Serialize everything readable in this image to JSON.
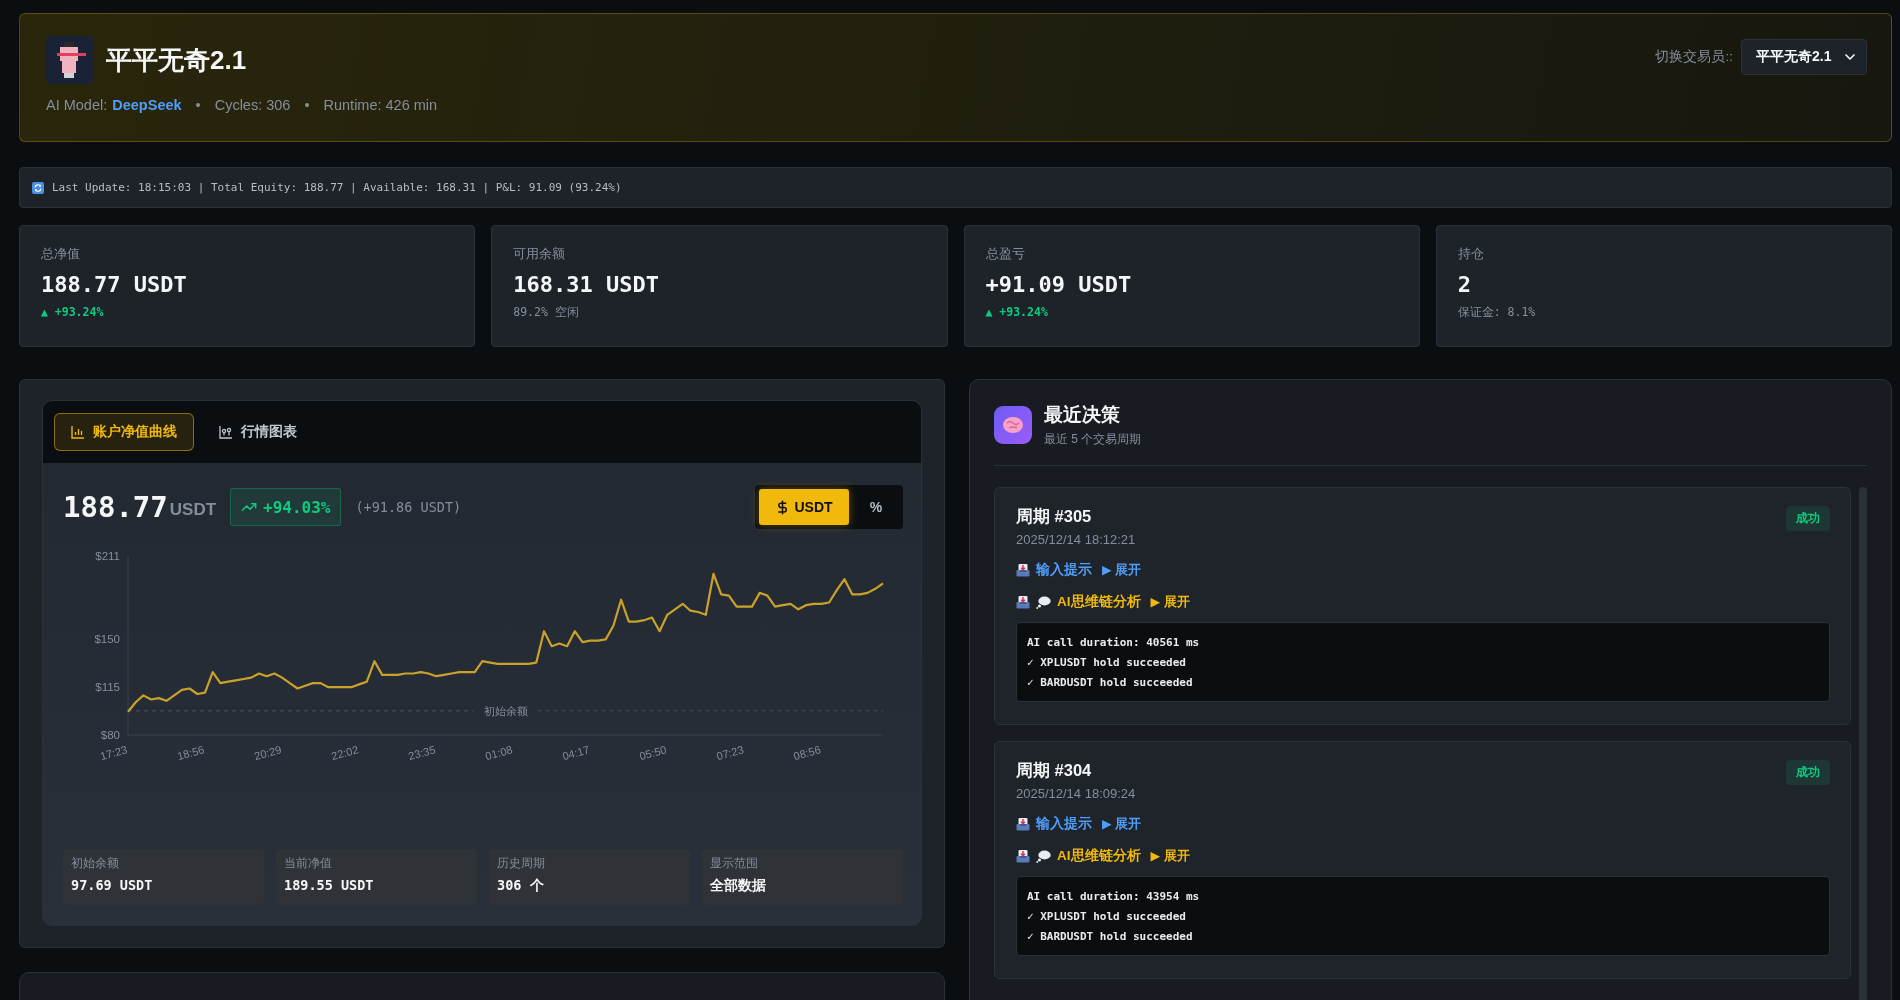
{
  "header": {
    "title": "平平无奇2.1",
    "model_label": "AI Model:",
    "model": "DeepSeek",
    "cycles": "Cycles: 306",
    "runtime": "Runtime: 426 min",
    "separators": [
      "•",
      "•"
    ]
  },
  "trader_switch": {
    "label": "切换交易员::",
    "value": "平平无奇2.1"
  },
  "status_bar": {
    "text": "Last Update: 18:15:03 | Total Equity: 188.77 | Available: 168.31 | P&L: 91.09 (93.24%)"
  },
  "stats": [
    {
      "label": "总净值",
      "value": "188.77 USDT",
      "sub": "▲ +93.24%",
      "kind": "change"
    },
    {
      "label": "可用余额",
      "value": "168.31 USDT",
      "sub": "89.2% 空闲",
      "kind": "note"
    },
    {
      "label": "总盈亏",
      "value": "+91.09 USDT",
      "sub": "▲ +93.24%",
      "kind": "change"
    },
    {
      "label": "持仓",
      "value": "2",
      "sub": "保证金: 8.1%",
      "kind": "note"
    }
  ],
  "equity_chart": {
    "tabs": [
      {
        "label": "账户净值曲线",
        "selected": true
      },
      {
        "label": "行情图表",
        "selected": false
      }
    ],
    "value": "188.77",
    "unit": "USDT",
    "change": "+94.03%",
    "change_amount": "(+91.86 USDT)",
    "unit_toggle": [
      {
        "label": "USDT",
        "selected": true
      },
      {
        "label": "%",
        "selected": false
      }
    ],
    "chart_data": {
      "type": "line",
      "categories": [
        "17:23",
        null,
        null,
        null,
        null,
        null,
        null,
        null,
        null,
        null,
        "18:56",
        null,
        null,
        null,
        null,
        null,
        null,
        null,
        null,
        null,
        "20:29",
        null,
        null,
        null,
        null,
        null,
        null,
        null,
        null,
        null,
        "22:02",
        null,
        null,
        null,
        null,
        null,
        null,
        null,
        null,
        null,
        "23:35",
        null,
        null,
        null,
        null,
        null,
        null,
        null,
        null,
        null,
        "01:08",
        null,
        null,
        null,
        null,
        null,
        null,
        null,
        null,
        null,
        "04:17",
        null,
        null,
        null,
        null,
        null,
        null,
        null,
        null,
        null,
        "05:50",
        null,
        null,
        null,
        null,
        null,
        null,
        null,
        null,
        null,
        "07:23",
        null,
        null,
        null,
        null,
        null,
        null,
        null,
        null,
        null,
        "08:56",
        null,
        null,
        null,
        null,
        null,
        null,
        null,
        null
      ],
      "values": [
        97,
        104,
        109,
        106,
        107,
        105,
        109,
        113,
        114,
        110,
        111,
        126,
        118,
        119,
        120,
        121,
        122,
        125,
        123,
        125,
        122,
        118,
        114,
        116,
        118,
        118,
        115,
        115,
        115,
        115,
        117,
        119,
        134,
        124,
        124,
        124,
        125,
        125,
        126,
        125,
        123,
        124,
        125,
        126,
        126,
        126,
        134,
        133,
        132,
        132,
        132,
        132,
        132,
        133,
        156,
        145,
        147,
        145,
        156,
        148,
        149,
        149,
        150,
        160,
        179,
        163,
        163,
        164,
        166,
        156,
        168,
        172,
        176,
        171,
        170,
        168,
        198,
        183,
        182,
        174,
        174,
        174,
        184,
        182,
        174,
        175,
        176,
        172,
        175,
        176,
        176,
        177,
        186,
        194,
        183,
        183,
        184,
        187,
        191
      ],
      "ylim": [
        80,
        211
      ],
      "yticks": [
        {
          "value": 211,
          "label": "$211"
        },
        {
          "value": 150,
          "label": "$150"
        },
        {
          "value": 115,
          "label": "$115"
        },
        {
          "value": 80,
          "label": "$80"
        }
      ],
      "ref_lines": [
        {
          "label": "初始余额"
        }
      ]
    },
    "summary": [
      {
        "label": "初始余额",
        "value": "97.69 USDT"
      },
      {
        "label": "当前净值",
        "value": "189.55 USDT"
      },
      {
        "label": "历史周期",
        "value": "306 个"
      },
      {
        "label": "显示范围",
        "value": "全部数据"
      }
    ]
  },
  "decisions": {
    "title": "最近决策",
    "subtitle": "最近 5 个交易周期",
    "cycles": [
      {
        "title": "周期 #305",
        "time": "2025/12/14 18:12:21",
        "status": "成功",
        "prompt_label": "输入提示",
        "prompt_toggle": "▶ 展开",
        "reasoning_label": "AI思维链分析",
        "reasoning_toggle": "▶ 展开",
        "log": [
          "AI call duration: 40561 ms",
          "✓ XPLUSDT hold succeeded",
          "✓ BARDUSDT hold succeeded"
        ]
      },
      {
        "title": "周期 #304",
        "time": "2025/12/14 18:09:24",
        "status": "成功",
        "prompt_label": "输入提示",
        "prompt_toggle": "▶ 展开",
        "reasoning_label": "AI思维链分析",
        "reasoning_toggle": "▶ 展开",
        "log": [
          "AI call duration: 43954 ms",
          "✓ XPLUSDT hold succeeded",
          "✓ BARDUSDT hold succeeded"
        ]
      }
    ]
  }
}
